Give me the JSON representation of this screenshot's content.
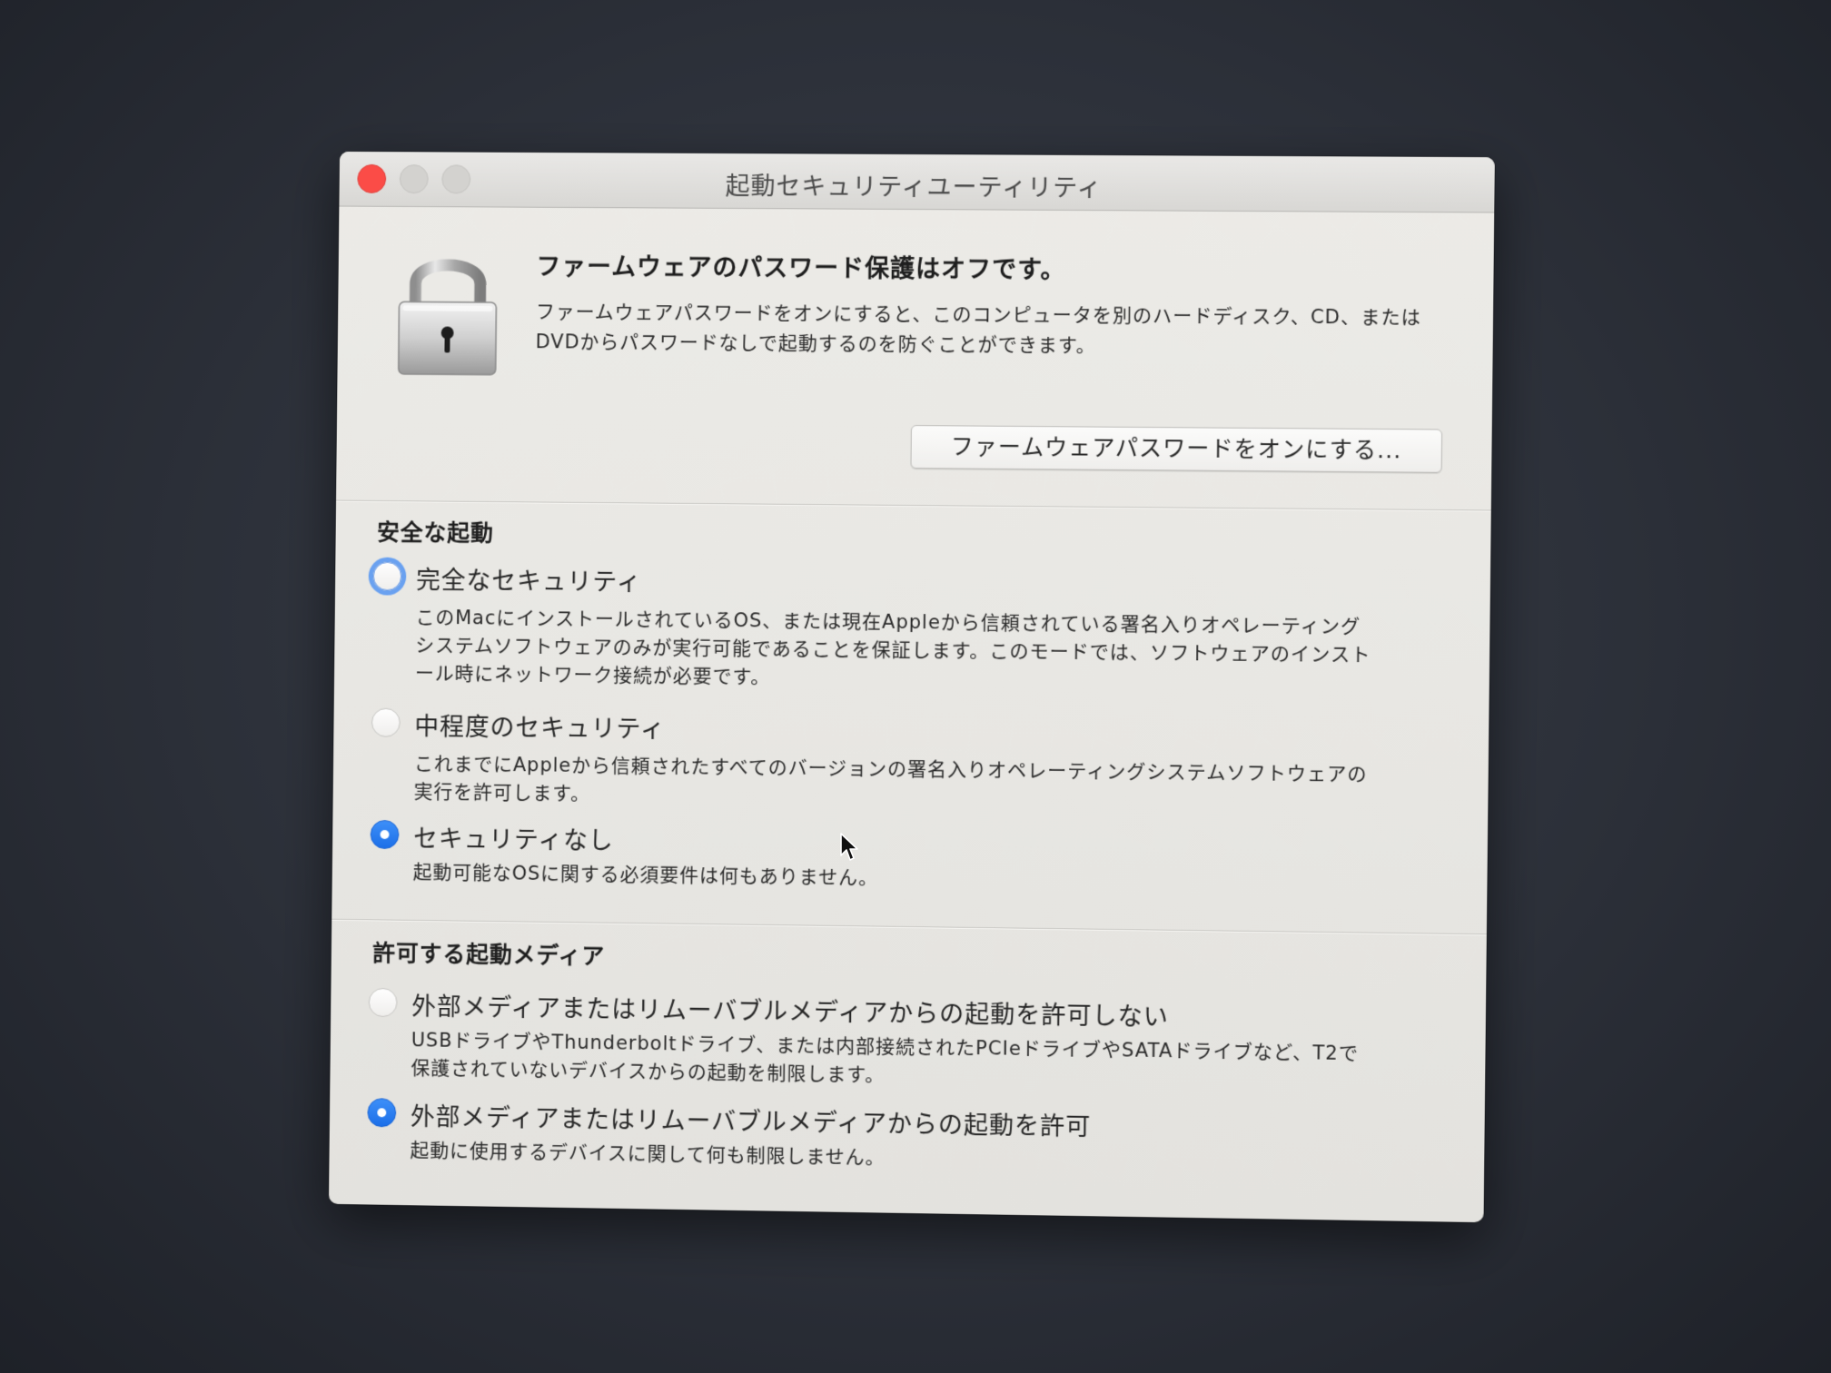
{
  "window": {
    "title": "起動セキュリティユーティリティ"
  },
  "firmware": {
    "title": "ファームウェアのパスワード保護はオフです。",
    "description": "ファームウェアパスワードをオンにすると、このコンピュータを別のハードディスク、CD、またはDVDからパスワードなしで起動するのを防ぐことができます。",
    "button_label": "ファームウェアパスワードをオンにする..."
  },
  "secure_boot": {
    "title": "安全な起動",
    "options": [
      {
        "label": "完全なセキュリティ",
        "description": "このMacにインストールされているOS、または現在Appleから信頼されている署名入りオペレーティングシステムソフトウェアのみが実行可能であることを保証します。このモードでは、ソフトウェアのインストール時にネットワーク接続が必要です。",
        "selected": false
      },
      {
        "label": "中程度のセキュリティ",
        "description": "これまでにAppleから信頼されたすべてのバージョンの署名入りオペレーティングシステムソフトウェアの実行を許可します。",
        "selected": false
      },
      {
        "label": "セキュリティなし",
        "description": "起動可能なOSに関する必須要件は何もありません。",
        "selected": true
      }
    ]
  },
  "boot_media": {
    "title": "許可する起動メディア",
    "options": [
      {
        "label": "外部メディアまたはリムーバブルメディアからの起動を許可しない",
        "description": "USBドライブやThunderboltドライブ、または内部接続されたPCIeドライブやSATAドライブなど、T2で保護されていないデバイスからの起動を制限します。",
        "selected": false
      },
      {
        "label": "外部メディアまたはリムーバブルメディアからの起動を許可",
        "description": "起動に使用するデバイスに関して何も制限しません。",
        "selected": true
      }
    ]
  },
  "colors": {
    "accent": "#1c6fe8",
    "close_button": "#fb4c47",
    "window_bg": "#e9e8e4",
    "desktop_bg": "#2c3039"
  },
  "icons": [
    "close-icon",
    "minimize-icon",
    "maximize-icon",
    "lock-icon",
    "cursor-icon"
  ]
}
